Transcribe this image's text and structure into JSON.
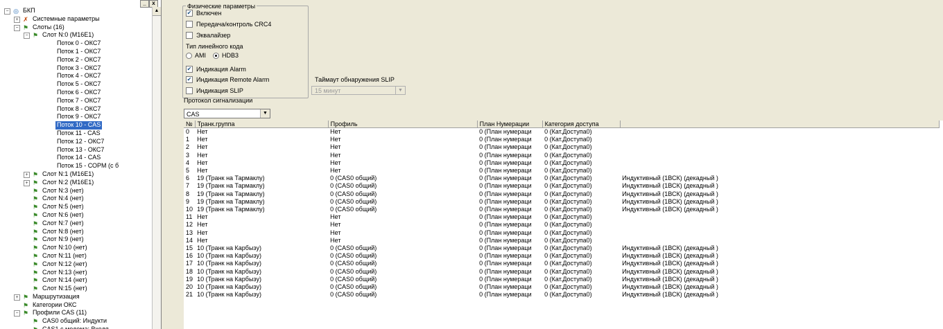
{
  "tree": {
    "toolbar": {
      "minimize": "_",
      "close": "x"
    },
    "nodes": [
      {
        "label": "БКП",
        "level": 0,
        "expander": "−",
        "icon": "root"
      },
      {
        "label": "Системные параметры",
        "level": 1,
        "expander": "+",
        "icon": "sys"
      },
      {
        "label": "Слоты (16)",
        "level": 1,
        "expander": "−",
        "icon": "slot"
      },
      {
        "label": "Слот N:0 (M16E1)",
        "level": 2,
        "expander": "−",
        "icon": "slot"
      },
      {
        "label": "Поток 0 - ОКС7",
        "level": 3
      },
      {
        "label": "Поток 1 - ОКС7",
        "level": 3
      },
      {
        "label": "Поток 2 - ОКС7",
        "level": 3
      },
      {
        "label": "Поток 3 - ОКС7",
        "level": 3
      },
      {
        "label": "Поток 4 - ОКС7",
        "level": 3
      },
      {
        "label": "Поток 5 - ОКС7",
        "level": 3
      },
      {
        "label": "Поток 6 - ОКС7",
        "level": 3
      },
      {
        "label": "Поток 7 - ОКС7",
        "level": 3
      },
      {
        "label": "Поток 8 - ОКС7",
        "level": 3
      },
      {
        "label": "Поток 9 - ОКС7",
        "level": 3
      },
      {
        "label": "Поток 10 - CAS",
        "level": 3,
        "selected": true
      },
      {
        "label": "Поток 11 - CAS",
        "level": 3
      },
      {
        "label": "Поток 12 - ОКС7",
        "level": 3
      },
      {
        "label": "Поток 13 - ОКС7",
        "level": 3
      },
      {
        "label": "Поток 14 - CAS",
        "level": 3
      },
      {
        "label": "Поток 15 - СОРМ (с б",
        "level": 3
      },
      {
        "label": "Слот N:1 (M16E1)",
        "level": 2,
        "expander": "+",
        "icon": "slot"
      },
      {
        "label": "Слот N:2 (M16E1)",
        "level": 2,
        "expander": "+",
        "icon": "slot"
      },
      {
        "label": "Слот N:3 (нет)",
        "level": 2,
        "icon": "slot"
      },
      {
        "label": "Слот N:4 (нет)",
        "level": 2,
        "icon": "slot"
      },
      {
        "label": "Слот N:5 (нет)",
        "level": 2,
        "icon": "slot"
      },
      {
        "label": "Слот N:6 (нет)",
        "level": 2,
        "icon": "slot"
      },
      {
        "label": "Слот N:7 (нет)",
        "level": 2,
        "icon": "slot"
      },
      {
        "label": "Слот N:8 (нет)",
        "level": 2,
        "icon": "slot"
      },
      {
        "label": "Слот N:9 (нет)",
        "level": 2,
        "icon": "slot"
      },
      {
        "label": "Слот N:10 (нет)",
        "level": 2,
        "icon": "slot"
      },
      {
        "label": "Слот N:11 (нет)",
        "level": 2,
        "icon": "slot"
      },
      {
        "label": "Слот N:12 (нет)",
        "level": 2,
        "icon": "slot"
      },
      {
        "label": "Слот N:13 (нет)",
        "level": 2,
        "icon": "slot"
      },
      {
        "label": "Слот N:14 (нет)",
        "level": 2,
        "icon": "slot"
      },
      {
        "label": "Слот N:15 (нет)",
        "level": 2,
        "icon": "slot"
      },
      {
        "label": "Маршрутизация",
        "level": 1,
        "expander": "+",
        "icon": "slot"
      },
      {
        "label": "Категории ОКС",
        "level": 1,
        "icon": "slot"
      },
      {
        "label": "Профили CAS (11)",
        "level": 1,
        "expander": "−",
        "icon": "slot"
      },
      {
        "label": "CAS0 общий: Индукти",
        "level": 2,
        "icon": "slot"
      },
      {
        "label": "CAS1 с модема: Входя",
        "level": 2,
        "icon": "slot"
      }
    ]
  },
  "physical": {
    "title": "Физические параметры",
    "enabled": {
      "label": "Включен",
      "checked": true
    },
    "crc4": {
      "label": "Передача/контроль CRC4",
      "checked": false
    },
    "equalizer": {
      "label": "Эквалайзер",
      "checked": false
    },
    "code_type_label": "Тип линейного кода",
    "ami": {
      "label": "AMI",
      "selected": false
    },
    "hdb3": {
      "label": "HDB3",
      "selected": true
    },
    "alarm": {
      "label": "Индикация Alarm",
      "checked": true
    },
    "remote_alarm": {
      "label": "Индикация Remote Alarm",
      "checked": true
    },
    "slip": {
      "label": "Индикация SLIP",
      "checked": false
    }
  },
  "slip_timeout": {
    "label": "Таймаут обнаружения SLIP",
    "value": "15 минут"
  },
  "signal_protocol": {
    "label": "Протокол сигнализации",
    "value": "CAS"
  },
  "table": {
    "columns": [
      "№",
      "Транк.группа",
      "Профиль",
      "План Нумерации",
      "Категория доступа",
      ""
    ],
    "rows": [
      [
        "0",
        "Нет",
        "Нет",
        "0 (План нумераци",
        "0 (Кат.Доступа0)",
        ""
      ],
      [
        "1",
        "Нет",
        "Нет",
        "0 (План нумераци",
        "0 (Кат.Доступа0)",
        ""
      ],
      [
        "2",
        "Нет",
        "Нет",
        "0 (План нумераци",
        "0 (Кат.Доступа0)",
        ""
      ],
      [
        "3",
        "Нет",
        "Нет",
        "0 (План нумераци",
        "0 (Кат.Доступа0)",
        ""
      ],
      [
        "4",
        "Нет",
        "Нет",
        "0 (План нумераци",
        "0 (Кат.Доступа0)",
        ""
      ],
      [
        "5",
        "Нет",
        "Нет",
        "0 (План нумераци",
        "0 (Кат.Доступа0)",
        ""
      ],
      [
        "6",
        "19 (Транк на Тармаклу)",
        "0 (CAS0 общий)",
        "0 (План нумераци",
        "0 (Кат.Доступа0)",
        "Индуктивный (1ВСК) (декадный )"
      ],
      [
        "7",
        "19 (Транк на Тармаклу)",
        "0 (CAS0 общий)",
        "0 (План нумераци",
        "0 (Кат.Доступа0)",
        "Индуктивный (1ВСК) (декадный )"
      ],
      [
        "8",
        "19 (Транк на Тармаклу)",
        "0 (CAS0 общий)",
        "0 (План нумераци",
        "0 (Кат.Доступа0)",
        "Индуктивный (1ВСК) (декадный )"
      ],
      [
        "9",
        "19 (Транк на Тармаклу)",
        "0 (CAS0 общий)",
        "0 (План нумераци",
        "0 (Кат.Доступа0)",
        "Индуктивный (1ВСК) (декадный )"
      ],
      [
        "10",
        "19 (Транк на Тармаклу)",
        "0 (CAS0 общий)",
        "0 (План нумераци",
        "0 (Кат.Доступа0)",
        "Индуктивный (1ВСК) (декадный )"
      ],
      [
        "11",
        "Нет",
        "Нет",
        "0 (План нумераци",
        "0 (Кат.Доступа0)",
        ""
      ],
      [
        "12",
        "Нет",
        "Нет",
        "0 (План нумераци",
        "0 (Кат.Доступа0)",
        ""
      ],
      [
        "13",
        "Нет",
        "Нет",
        "0 (План нумераци",
        "0 (Кат.Доступа0)",
        ""
      ],
      [
        "14",
        "Нет",
        "Нет",
        "0 (План нумераци",
        "0 (Кат.Доступа0)",
        ""
      ],
      [
        "15",
        "10 (Транк на Карбызу)",
        "0 (CAS0 общий)",
        "0 (План нумераци",
        "0 (Кат.Доступа0)",
        "Индуктивный (1ВСК) (декадный )"
      ],
      [
        "16",
        "10 (Транк на Карбызу)",
        "0 (CAS0 общий)",
        "0 (План нумераци",
        "0 (Кат.Доступа0)",
        "Индуктивный (1ВСК) (декадный )"
      ],
      [
        "17",
        "10 (Транк на Карбызу)",
        "0 (CAS0 общий)",
        "0 (План нумераци",
        "0 (Кат.Доступа0)",
        "Индуктивный (1ВСК) (декадный )"
      ],
      [
        "18",
        "10 (Транк на Карбызу)",
        "0 (CAS0 общий)",
        "0 (План нумераци",
        "0 (Кат.Доступа0)",
        "Индуктивный (1ВСК) (декадный )"
      ],
      [
        "19",
        "10 (Транк на Карбызу)",
        "0 (CAS0 общий)",
        "0 (План нумераци",
        "0 (Кат.Доступа0)",
        "Индуктивный (1ВСК) (декадный )"
      ],
      [
        "20",
        "10 (Транк на Карбызу)",
        "0 (CAS0 общий)",
        "0 (План нумераци",
        "0 (Кат.Доступа0)",
        "Индуктивный (1ВСК) (декадный )"
      ],
      [
        "21",
        "10 (Транк на Карбызу)",
        "0 (CAS0 общий)",
        "0 (План нумераци",
        "0 (Кат.Доступа0)",
        "Индуктивный (1ВСК) (декадный )"
      ]
    ]
  }
}
